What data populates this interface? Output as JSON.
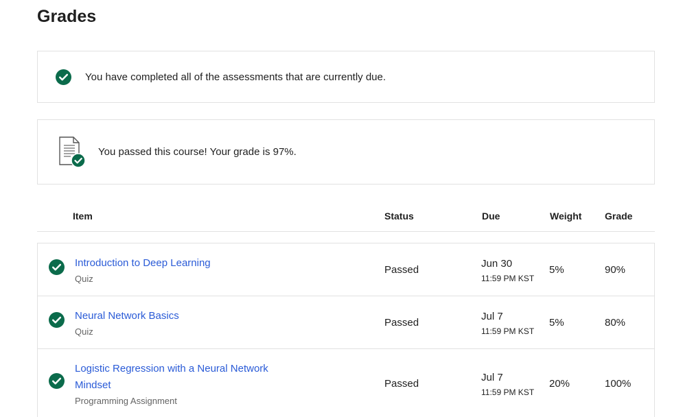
{
  "page": {
    "title": "Grades"
  },
  "notices": {
    "complete_message": "You have completed all of the assessments that are currently due.",
    "passed_message": "You passed this course! Your grade is 97%."
  },
  "table": {
    "headers": {
      "item": "Item",
      "status": "Status",
      "due": "Due",
      "weight": "Weight",
      "grade": "Grade"
    },
    "rows": [
      {
        "title": "Introduction to Deep Learning",
        "type": "Quiz",
        "status": "Passed",
        "due_date": "Jun 30",
        "due_time": "11:59 PM KST",
        "weight": "5%",
        "grade": "90%"
      },
      {
        "title": "Neural Network Basics",
        "type": "Quiz",
        "status": "Passed",
        "due_date": "Jul 7",
        "due_time": "11:59 PM KST",
        "weight": "5%",
        "grade": "80%"
      },
      {
        "title": "Logistic Regression with a Neural Network Mindset",
        "type": "Programming Assignment",
        "status": "Passed",
        "due_date": "Jul 7",
        "due_time": "11:59 PM KST",
        "weight": "20%",
        "grade": "100%"
      }
    ]
  },
  "colors": {
    "success": "#0b6b4b",
    "link": "#2a5bd7",
    "border": "#e1e1e1"
  },
  "icons": {
    "check": "check-circle-icon",
    "document": "graded-document-icon"
  }
}
